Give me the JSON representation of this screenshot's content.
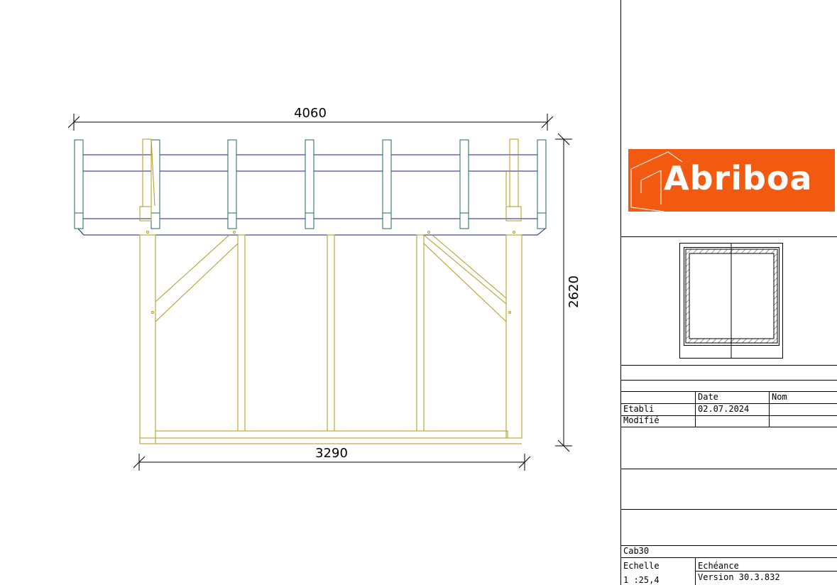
{
  "drawing": {
    "dimensions": {
      "top_width": "4060",
      "bottom_width": "3290",
      "height": "2620"
    },
    "colors": {
      "rafter": "#1e6b5a",
      "purlin": "#1a1a8c",
      "timber": "#b29a1a",
      "dimension": "#000000"
    }
  },
  "titleblock": {
    "logo_text": "Abriboa",
    "date_header": "Date",
    "name_header": "Nom",
    "etabli_label": "Etabli",
    "etabli_date": "02.07.2024",
    "modifie_label": "Modifié",
    "project": "Cab30",
    "echelle_label": "Echelle",
    "echelle_value": "1 :25,4",
    "echeance_label": "Echéance",
    "version": "Version 30.3.832"
  }
}
